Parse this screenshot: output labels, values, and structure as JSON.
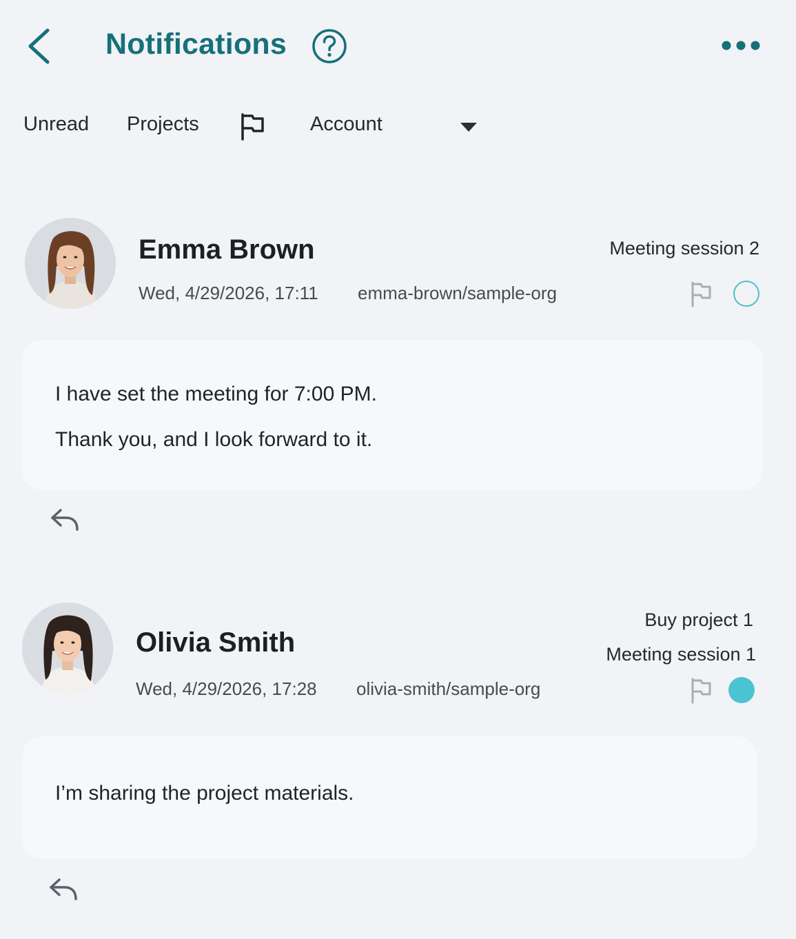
{
  "header": {
    "title": "Notifications"
  },
  "filters": {
    "unread": "Unread",
    "projects": "Projects",
    "account": "Account"
  },
  "notifications": [
    {
      "sender": "Emma Brown",
      "datetime": "Wed, 4/29/2026, 17:11",
      "org": "emma-brown/sample-org",
      "tags": [
        "Meeting session 2"
      ],
      "read": false,
      "message": [
        "I have set the meeting for 7:00 PM.",
        "Thank you, and I look forward to it."
      ]
    },
    {
      "sender": "Olivia Smith",
      "datetime": "Wed, 4/29/2026, 17:28",
      "org": "olivia-smith/sample-org",
      "tags": [
        "Buy project 1",
        "Meeting session 1"
      ],
      "read": true,
      "message": [
        "I’m sharing the project materials."
      ]
    }
  ],
  "colors": {
    "accent": "#16707a",
    "status": "#4cc3d1",
    "background": "#f1f3f6",
    "card": "#f7f8fa"
  }
}
